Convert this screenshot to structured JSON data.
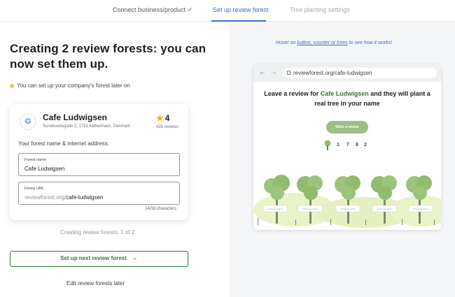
{
  "steps": [
    {
      "label": "Connect business/product ✓"
    },
    {
      "label": "Set up review forest"
    },
    {
      "label": "Tree planting settings"
    }
  ],
  "left": {
    "heading": "Creating 2 review forests: you can now set them up.",
    "hint": "You can set up your company's forest later on",
    "business": {
      "name": "Cafe Ludwigsen",
      "address": "Sundevedsgade 2, 1751 København, Denmark",
      "rating": "4",
      "reviews": "428 reviews",
      "logo_letter": "G"
    },
    "forest_label": "Your forest name & internet address:",
    "name_field": {
      "label": "Forest name",
      "value": "Cafe Ludwigsen"
    },
    "url_field": {
      "label": "Forest URL",
      "prefix": "reviewforest.org/",
      "value": "cafe-ludwigsen"
    },
    "char_count": "14/18 characters",
    "progress": "Creating review forests: 1 of 2",
    "next_button": "Set up next review forest",
    "later_button": "Edit review forests later"
  },
  "right": {
    "hint_prefix": "Hover on ",
    "hint_link": "button, counter or trees",
    "hint_suffix": " to see how it works!",
    "browser_url": "reviewforest.org/cafe-ludwigsen",
    "preview_pre": "Leave a review for ",
    "preview_biz": "Cafe Ludwigsen",
    "preview_post": " and they will plant a real tree in your name",
    "write_button": "Write a review",
    "counter_digits": [
      "1",
      "7",
      "8",
      "2"
    ],
    "tree_label": "Customer name"
  },
  "colors": {
    "accent_blue": "#3a6fd1",
    "accent_green": "#2e7d32",
    "tree_green": "#8fbc6d",
    "star": "#f4b400"
  }
}
